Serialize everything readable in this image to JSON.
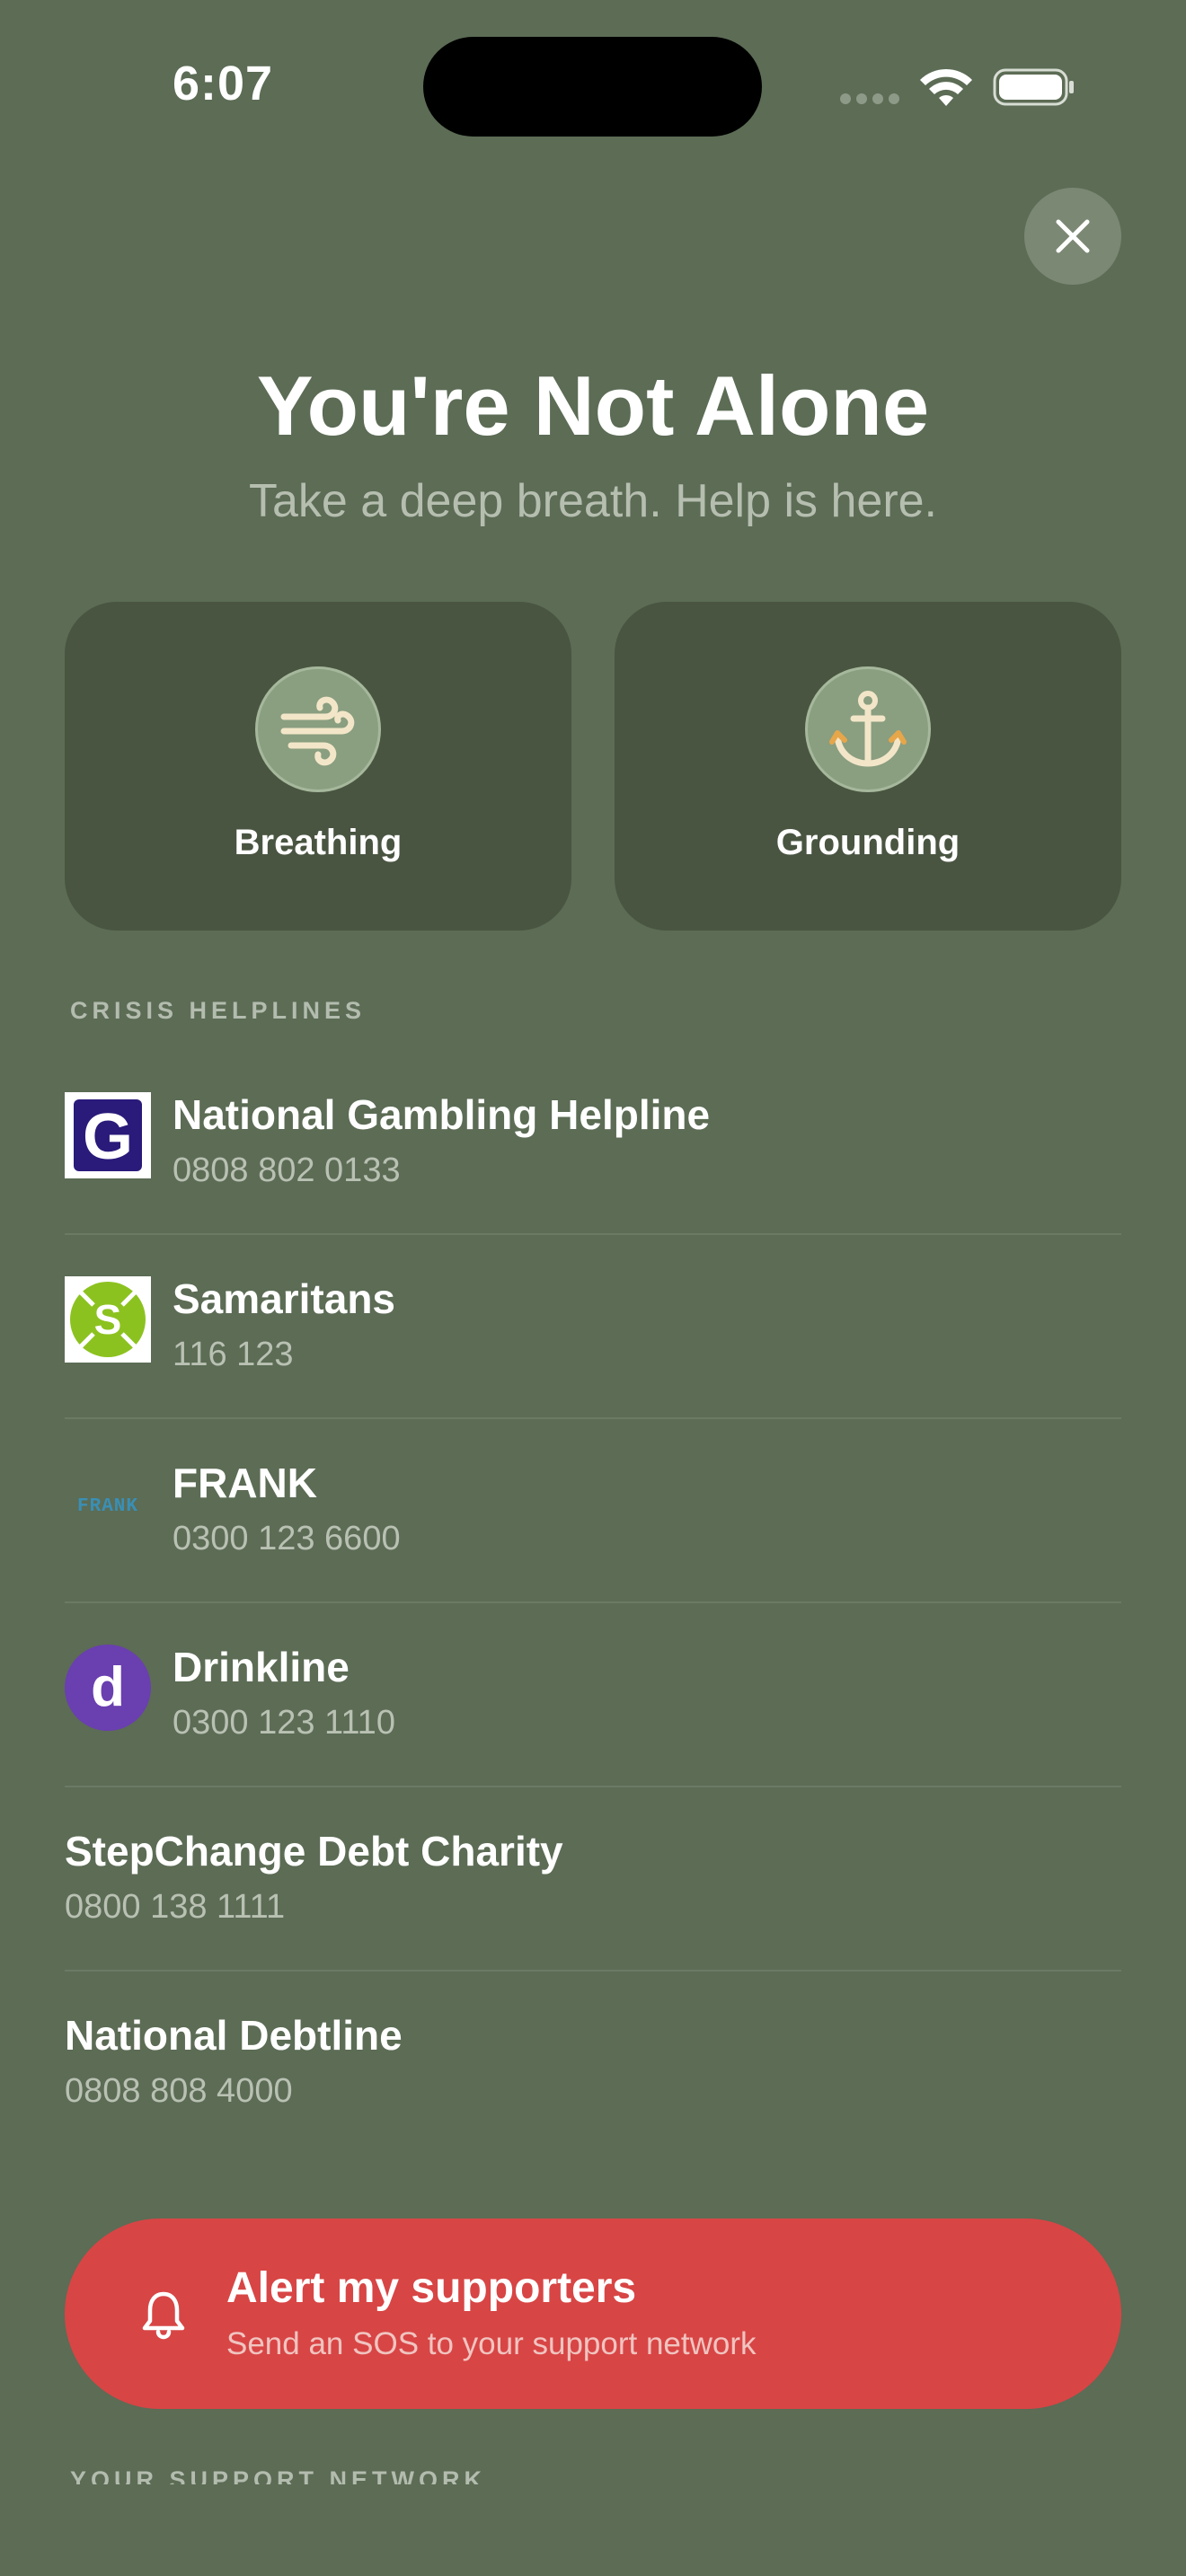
{
  "status_bar": {
    "time": "6:07"
  },
  "header": {
    "title": "You're Not Alone",
    "subtitle": "Take a deep breath. Help is here."
  },
  "tools": [
    {
      "label": "Breathing",
      "icon": "wind-icon"
    },
    {
      "label": "Grounding",
      "icon": "anchor-icon"
    }
  ],
  "helplines_section": {
    "label": "CRISIS HELPLINES",
    "items": [
      {
        "name": "National Gambling Helpline",
        "phone": "0808 802 0133",
        "logo": "G"
      },
      {
        "name": "Samaritans",
        "phone": "116 123",
        "logo": "S"
      },
      {
        "name": "FRANK",
        "phone": "0300 123 6600",
        "logo": "FRANK"
      },
      {
        "name": "Drinkline",
        "phone": "0300 123 1110",
        "logo": "d"
      },
      {
        "name": "StepChange Debt Charity",
        "phone": "0800 138 1111"
      },
      {
        "name": "National Debtline",
        "phone": "0808 808 4000"
      }
    ]
  },
  "sos": {
    "title": "Alert my supporters",
    "subtitle": "Send an SOS to your support network"
  },
  "next_section_label": "YOUR SUPPORT NETWORK",
  "colors": {
    "background": "#5c6c55",
    "card": "#495541",
    "sos": "#d84545"
  }
}
